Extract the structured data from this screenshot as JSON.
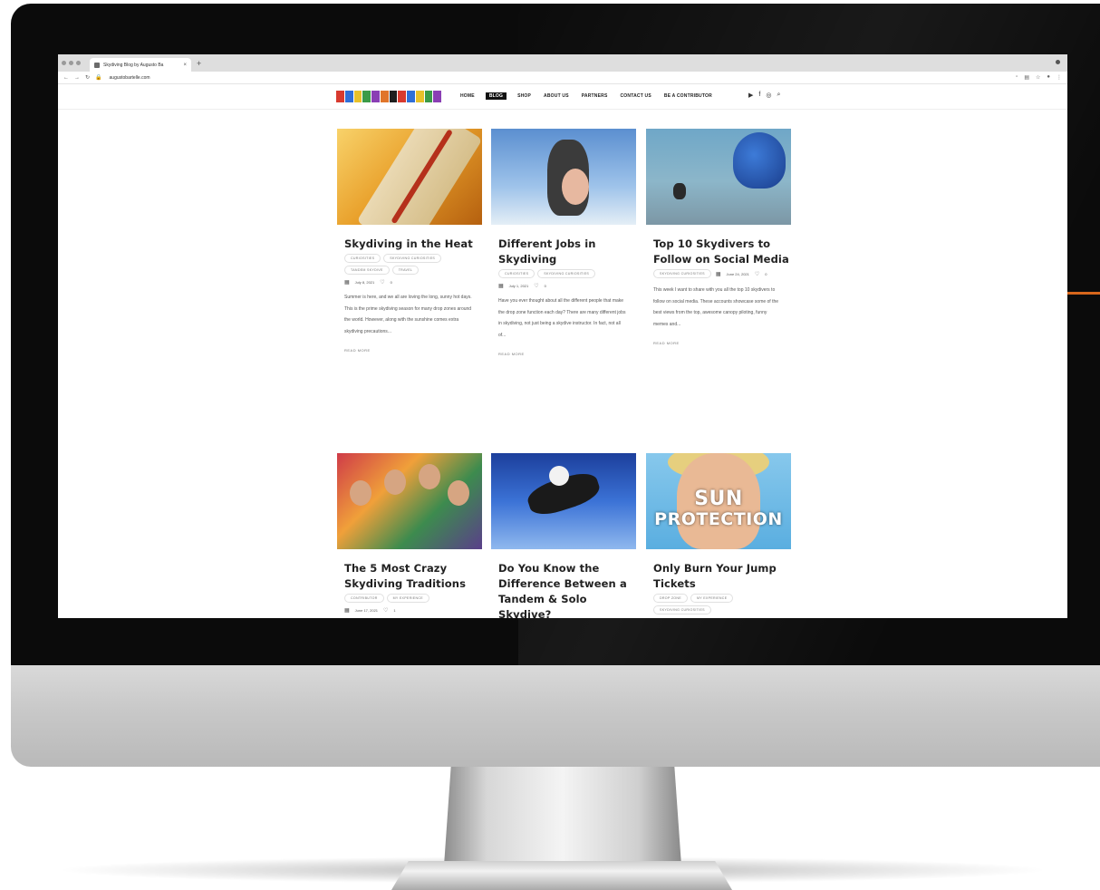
{
  "browser": {
    "tab_title": "Skydiving Blog by Augusto Ba",
    "tab_close": "×",
    "new_tab": "+",
    "url": "augustobartelle.com"
  },
  "site": {
    "nav": [
      {
        "label": "HOME",
        "active": false
      },
      {
        "label": "BLOG",
        "active": true
      },
      {
        "label": "SHOP",
        "active": false
      },
      {
        "label": "ABOUT US",
        "active": false
      },
      {
        "label": "PARTNERS",
        "active": false
      },
      {
        "label": "CONTACT US",
        "active": false
      },
      {
        "label": "BE A CONTRIBUTOR",
        "active": false
      }
    ],
    "social_icons": [
      "youtube-icon",
      "facebook-icon",
      "instagram-icon",
      "search-icon"
    ],
    "logo_colors": [
      "#d83a2f",
      "#2f6fd8",
      "#e8c12a",
      "#3b9b47",
      "#8a3fb4",
      "#e0752a",
      "#1e1e1e",
      "#d83a2f",
      "#2f6fd8",
      "#e8c12a",
      "#3b9b47",
      "#8a3fb4"
    ]
  },
  "posts": [
    {
      "title": "Skydiving in the Heat",
      "tags": [
        "Curiosities",
        "Skydiving Curiosities",
        "Tandem Skydive",
        "Travel"
      ],
      "date": "July 8, 2021",
      "comments": "0",
      "excerpt": "Summer is here, and we all are loving the long, sunny hot days. This is the prime skydiving season for many drop zones around the world. However, along with the sunshine comes extra skydiving precautions...",
      "read_more": "Read more"
    },
    {
      "title": "Different Jobs in Skydiving",
      "tags": [
        "Curiosities",
        "Skydiving Curiosities"
      ],
      "date": "July 1, 2021",
      "comments": "0",
      "excerpt": "Have you ever thought about all the different people that make the drop zone function each day? There are many different jobs in skydiving, not just being a skydive instructor. In fact, not all of...",
      "read_more": "Read more"
    },
    {
      "title": "Top 10 Skydivers to Follow on Social Media",
      "tags": [
        "Skydiving Curiosities"
      ],
      "date": "June 24, 2021",
      "comments": "0",
      "excerpt": "This week I want to share with you all the top 10 skydivers to follow on social media. These accounts showcase some of the best views from the top, awesome canopy piloting, funny memes and...",
      "read_more": "Read more"
    },
    {
      "title": "The 5 Most Crazy Skydiving Traditions",
      "tags": [
        "Contributor",
        "My Experience"
      ],
      "date": "June 17, 2021",
      "comments": "1"
    },
    {
      "title": "Do You Know the Difference Between a Tandem & Solo Skydive?"
    },
    {
      "title": "Only Burn Your Jump Tickets",
      "tags": [
        "Drop Zone",
        "My Experience",
        "Skydiving Curiosities"
      ],
      "image_text_1": "SUN",
      "image_text_2": "PROTECTION"
    }
  ]
}
